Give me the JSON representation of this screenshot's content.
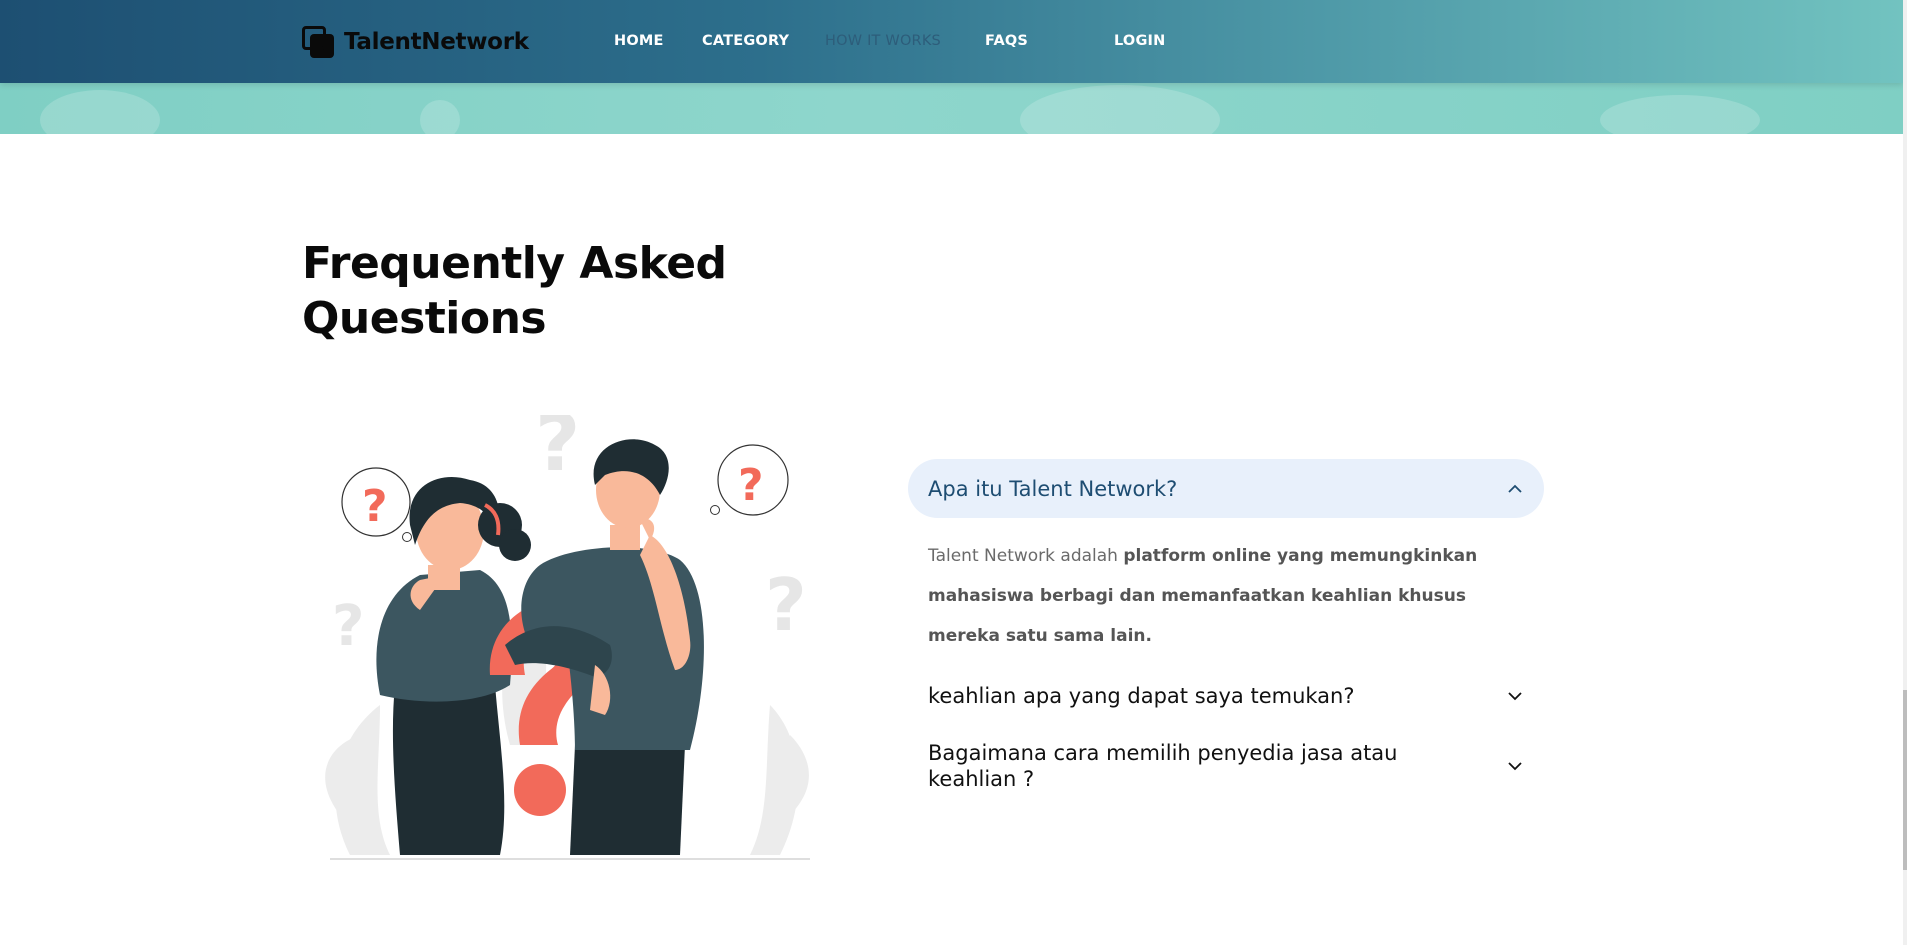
{
  "brand": {
    "name": "TalentNetwork"
  },
  "nav": {
    "items": [
      {
        "label": "HOME",
        "active": false
      },
      {
        "label": "CATEGORY",
        "active": false
      },
      {
        "label": "HOW IT WORKS",
        "active": true
      },
      {
        "label": "FAQS",
        "active": false
      },
      {
        "label": "LOGIN",
        "active": false
      }
    ]
  },
  "faq": {
    "title_line1": "Frequently Asked",
    "title_line2": "Questions",
    "items": [
      {
        "question": "Apa itu Talent Network?",
        "expanded": true,
        "answer_plain": "Talent Network adalah ",
        "answer_bold": "platform online yang memungkinkan mahasiswa berbagi dan memanfaatkan keahlian khusus mereka satu sama lain."
      },
      {
        "question": "keahlian apa yang dapat saya temukan?",
        "expanded": false
      },
      {
        "question": "Bagaimana cara memilih penyedia jasa atau keahlian ?",
        "expanded": false
      }
    ]
  },
  "colors": {
    "nav_gradient_start": "#1d4f72",
    "nav_gradient_end": "#72c3c0",
    "hero_teal": "#8ed6cc",
    "active_question_bg": "#e8f0fb",
    "active_question_text": "#1e4d72",
    "illustration_accent": "#f26a5a",
    "illustration_dark": "#3c5660"
  },
  "icons": {
    "logo": "overlapping-squares-icon",
    "expanded": "chevron-up-icon",
    "collapsed": "chevron-down-icon"
  },
  "illustration": {
    "subject": "two people thinking with question marks"
  }
}
